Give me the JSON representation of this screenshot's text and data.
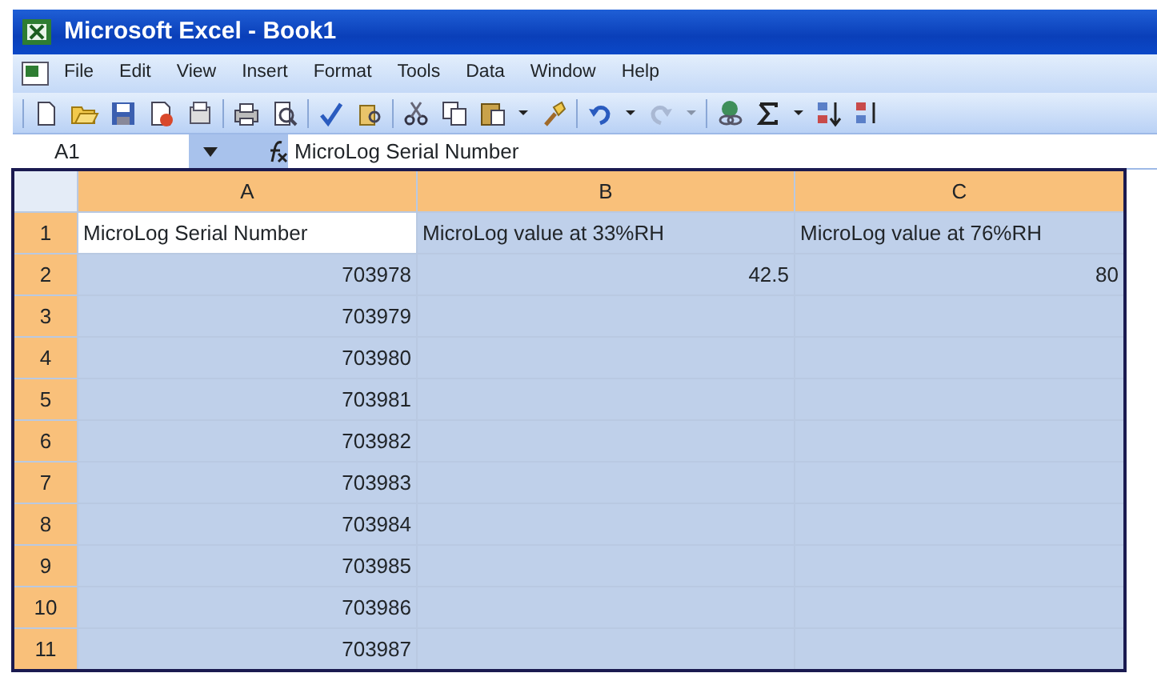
{
  "window": {
    "title": "Microsoft Excel - Book1"
  },
  "menu": [
    "File",
    "Edit",
    "View",
    "Insert",
    "Format",
    "Tools",
    "Data",
    "Window",
    "Help"
  ],
  "formula_bar": {
    "name_box": "A1",
    "formula": "MicroLog Serial Number"
  },
  "columns": [
    {
      "label": "A",
      "selected": true
    },
    {
      "label": "B",
      "selected": true
    },
    {
      "label": "C",
      "selected": true
    }
  ],
  "rows": [
    {
      "label": "1",
      "selected": true,
      "cells": [
        {
          "kind": "text",
          "text": "MicroLog Serial Number",
          "active": true
        },
        {
          "kind": "text",
          "text": "MicroLog value at 33%RH",
          "active": false
        },
        {
          "kind": "text",
          "text": "MicroLog value at 76%RH",
          "active": false
        }
      ]
    },
    {
      "label": "2",
      "selected": true,
      "cells": [
        {
          "kind": "number",
          "text": "703978",
          "active": false
        },
        {
          "kind": "number",
          "text": "42.5",
          "active": false
        },
        {
          "kind": "number",
          "text": "80",
          "active": false
        }
      ]
    },
    {
      "label": "3",
      "selected": true,
      "cells": [
        {
          "kind": "number",
          "text": "703979",
          "active": false
        },
        {
          "kind": "empty",
          "active": false
        },
        {
          "kind": "empty",
          "active": false
        }
      ]
    },
    {
      "label": "4",
      "selected": true,
      "cells": [
        {
          "kind": "number",
          "text": "703980",
          "active": false
        },
        {
          "kind": "empty",
          "active": false
        },
        {
          "kind": "empty",
          "active": false
        }
      ]
    },
    {
      "label": "5",
      "selected": true,
      "cells": [
        {
          "kind": "number",
          "text": "703981",
          "active": false
        },
        {
          "kind": "empty",
          "active": false
        },
        {
          "kind": "empty",
          "active": false
        }
      ]
    },
    {
      "label": "6",
      "selected": true,
      "cells": [
        {
          "kind": "number",
          "text": "703982",
          "active": false
        },
        {
          "kind": "empty",
          "active": false
        },
        {
          "kind": "empty",
          "active": false
        }
      ]
    },
    {
      "label": "7",
      "selected": true,
      "cells": [
        {
          "kind": "number",
          "text": "703983",
          "active": false
        },
        {
          "kind": "empty",
          "active": false
        },
        {
          "kind": "empty",
          "active": false
        }
      ]
    },
    {
      "label": "8",
      "selected": true,
      "cells": [
        {
          "kind": "number",
          "text": "703984",
          "active": false
        },
        {
          "kind": "empty",
          "active": false
        },
        {
          "kind": "empty",
          "active": false
        }
      ]
    },
    {
      "label": "9",
      "selected": true,
      "cells": [
        {
          "kind": "number",
          "text": "703985",
          "active": false
        },
        {
          "kind": "empty",
          "active": false
        },
        {
          "kind": "empty",
          "active": false
        }
      ]
    },
    {
      "label": "10",
      "selected": true,
      "cells": [
        {
          "kind": "number",
          "text": "703986",
          "active": false
        },
        {
          "kind": "empty",
          "active": false
        },
        {
          "kind": "empty",
          "active": false
        }
      ]
    },
    {
      "label": "11",
      "selected": true,
      "cells": [
        {
          "kind": "number",
          "text": "703987",
          "active": false
        },
        {
          "kind": "empty",
          "active": false
        },
        {
          "kind": "empty",
          "active": false
        }
      ]
    }
  ]
}
